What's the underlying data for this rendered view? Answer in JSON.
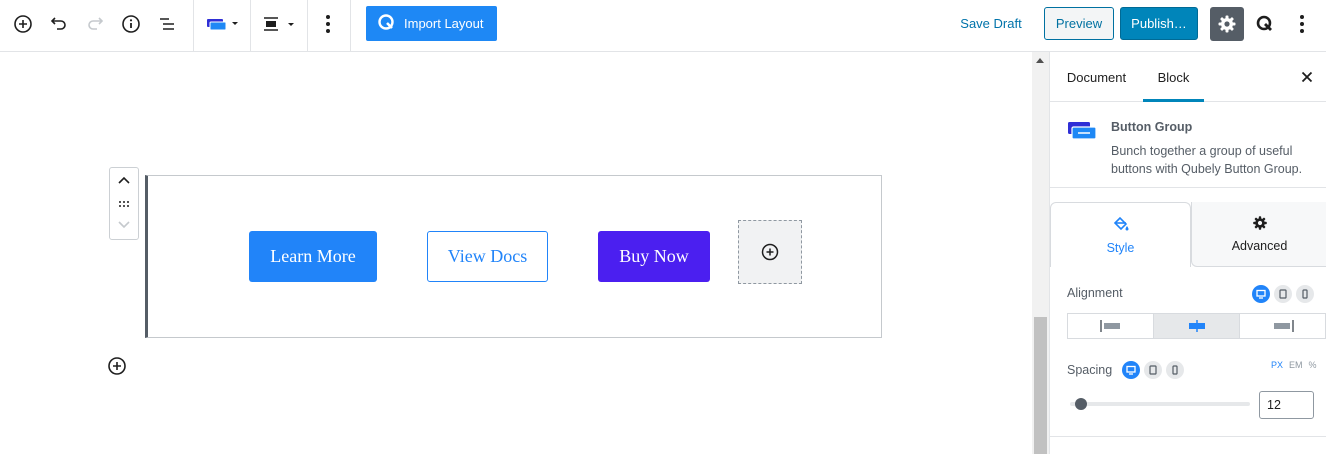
{
  "toolbar": {
    "import_label": "Import Layout",
    "save_draft": "Save Draft",
    "preview": "Preview",
    "publish": "Publish…",
    "accent": "#1e88f5"
  },
  "buttons": {
    "learn_more": "Learn More",
    "view_docs": "View Docs",
    "buy_now": "Buy Now"
  },
  "sidebar": {
    "tabs": {
      "document": "Document",
      "block": "Block"
    },
    "block_card": {
      "title": "Button Group",
      "description": "Bunch together a group of useful buttons with Qubely Button Group."
    },
    "style_tabs": {
      "style": "Style",
      "advanced": "Advanced"
    },
    "alignment": {
      "label": "Alignment",
      "selected": "center"
    },
    "spacing": {
      "label": "Spacing",
      "value": "12",
      "units": [
        "PX",
        "EM",
        "%"
      ],
      "active_unit": "PX"
    }
  }
}
